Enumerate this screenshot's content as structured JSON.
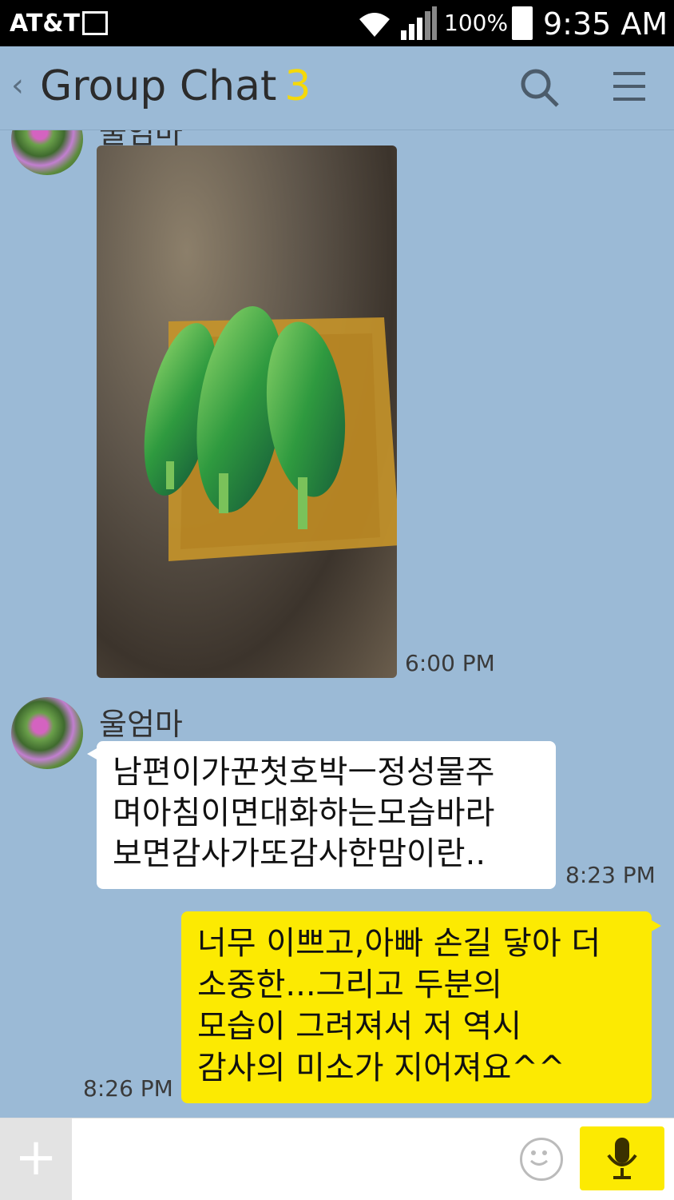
{
  "status_bar": {
    "carrier": "AT&T",
    "battery": "100%",
    "time": "9:35 AM"
  },
  "header": {
    "title": "Group Chat",
    "member_count": "3"
  },
  "messages": [
    {
      "sender": "울엄마",
      "type": "image",
      "image_description_icon": "zucchini-photo",
      "time": "6:00 PM"
    },
    {
      "sender": "울엄마",
      "type": "text",
      "lines": [
        "남편이가꾼첫호박ㅡ정성물주",
        "며아침이면대화하는모습바라",
        "보면감사가또감사한맘이란.."
      ],
      "time": "8:23 PM"
    },
    {
      "sender": "me",
      "type": "text",
      "lines": [
        "너무 이쁘고,아빠 손길 닿아 더",
        "소중한...그리고 두분의",
        "모습이 그려져서 저 역시",
        "감사의 미소가 지어져요^^"
      ],
      "time": "8:26 PM"
    }
  ],
  "colors": {
    "chat_background": "#9bbad6",
    "outgoing_bubble": "#fcea02",
    "incoming_bubble": "#ffffff"
  }
}
